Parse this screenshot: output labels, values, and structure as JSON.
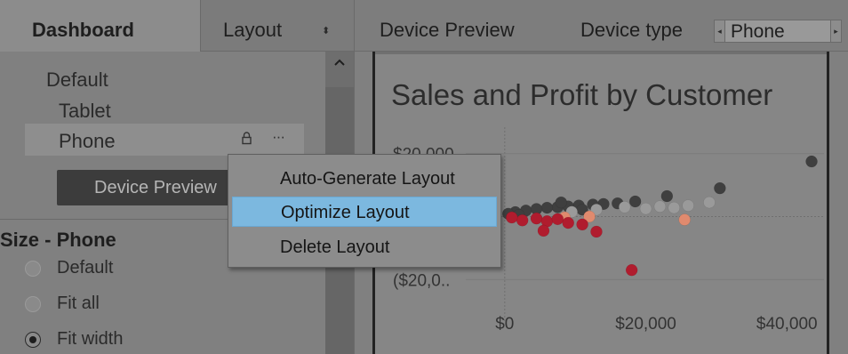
{
  "tabs": {
    "dashboard": "Dashboard",
    "layout": "Layout",
    "layout_updown": "⬍"
  },
  "devices": {
    "default": "Default",
    "tablet": "Tablet",
    "phone": "Phone",
    "lock_icon": "lock-icon",
    "more_icon": "···"
  },
  "device_preview_button": "Device Preview",
  "size": {
    "title": "Size - Phone",
    "options": [
      "Default",
      "Fit all",
      "Fit width"
    ],
    "selected": "Fit width"
  },
  "topbar": {
    "preview_label": "Device Preview",
    "device_type_label": "Device type",
    "device_type_value": "Phone",
    "left_arrow": "◂",
    "right_arrow": "▸"
  },
  "context_menu": {
    "items": [
      "Auto-Generate Layout",
      "Optimize Layout",
      "Delete Layout"
    ],
    "highlighted": "Optimize Layout"
  },
  "colors": {
    "highlight": "#7cb8df",
    "button_dark": "#3c3c3c",
    "dot_dark": "#3f3f3f",
    "dot_red": "#b01c2e",
    "dot_salmon": "#e08a6e"
  },
  "chart_data": {
    "type": "scatter",
    "title": "Sales and Profit by Customer",
    "y_tick_labels": [
      "$20,000",
      "($20,0.."
    ],
    "x_tick_labels": [
      "$0",
      "$20,000",
      "$40,000"
    ],
    "xlim": [
      -3000,
      44000
    ],
    "ylim": [
      -25000,
      25000
    ],
    "series": [
      {
        "name": "dark",
        "color": "#3f3f3f",
        "points": [
          [
            43500,
            17500
          ],
          [
            30500,
            9000
          ],
          [
            23000,
            6500
          ],
          [
            18500,
            4800
          ],
          [
            16000,
            4200
          ],
          [
            14000,
            4000
          ],
          [
            12500,
            3800
          ],
          [
            10500,
            3500
          ],
          [
            9000,
            3200
          ],
          [
            7500,
            3000
          ],
          [
            6000,
            2800
          ],
          [
            4500,
            2400
          ],
          [
            3000,
            1900
          ],
          [
            1500,
            1400
          ],
          [
            500,
            900
          ],
          [
            2000,
            500
          ],
          [
            8000,
            4500
          ],
          [
            11000,
            2200
          ]
        ]
      },
      {
        "name": "light",
        "color": "#9a9a9a",
        "points": [
          [
            29000,
            4500
          ],
          [
            26000,
            3500
          ],
          [
            24000,
            2800
          ],
          [
            22000,
            3200
          ],
          [
            20000,
            2500
          ],
          [
            17000,
            3000
          ],
          [
            13000,
            2200
          ],
          [
            9500,
            1500
          ]
        ]
      },
      {
        "name": "salmon",
        "color": "#e08a6e",
        "points": [
          [
            25500,
            -1000
          ],
          [
            12000,
            0
          ],
          [
            8500,
            -300
          ]
        ]
      },
      {
        "name": "red",
        "color": "#b01c2e",
        "points": [
          [
            2500,
            -1200
          ],
          [
            4500,
            -600
          ],
          [
            6000,
            -1500
          ],
          [
            7500,
            -800
          ],
          [
            9000,
            -2000
          ],
          [
            11000,
            -2500
          ],
          [
            5500,
            -4500
          ],
          [
            13000,
            -4800
          ],
          [
            18000,
            -17000
          ],
          [
            1000,
            -300
          ]
        ]
      }
    ]
  }
}
